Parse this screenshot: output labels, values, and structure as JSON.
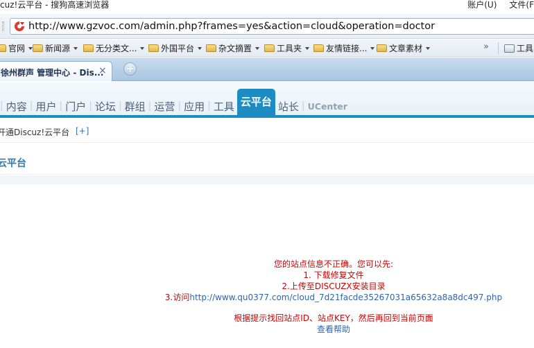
{
  "window": {
    "title": "cuz!云平台 - 搜狗高速浏览器",
    "menus": [
      "账户(U)",
      "文件(F"
    ]
  },
  "address": {
    "url": "http://www.gzvoc.com/admin.php?frames=yes&action=cloud&operation=doctor"
  },
  "bookmarks": {
    "items": [
      {
        "label": "官网",
        "menu": true
      },
      {
        "label": "新闻源",
        "menu": true
      },
      {
        "label": "无分类文...",
        "menu": true
      },
      {
        "label": "外国平台",
        "menu": true
      },
      {
        "label": "杂文摘置",
        "menu": true
      },
      {
        "label": "工具夹",
        "menu": true
      },
      {
        "label": "友情链接...",
        "menu": true
      },
      {
        "label": "文章素材",
        "menu": true
      }
    ],
    "more": "»",
    "tools_label": "工具"
  },
  "tabs": {
    "active_title": "徐州群声 管理中心 - Dis...",
    "close": "×",
    "new_tab": "+"
  },
  "admin_nav": {
    "items": [
      "内容",
      "用户",
      "门户",
      "论坛",
      "群组",
      "运营",
      "应用",
      "工具",
      "云平台",
      "站长",
      "UCenter"
    ],
    "active_index": 8
  },
  "breadcrumb": {
    "text": "开通Discuz!云平台",
    "action": "[+]"
  },
  "section": {
    "title": "云平台"
  },
  "message": {
    "line1": "您的站点信息不正确。您可以先:",
    "line2": "1. 下载修复文件",
    "line3": "2.上传至DISCUZX安装目录",
    "line4_prefix": "3.访问",
    "line4_link": "http://www.qu0377.com/cloud_7d21facde35267031a65632a8a8dc497.php",
    "line5": "根据提示找回站点ID、站点KEY，然后再回到当前页面",
    "help_link": "查看帮助"
  },
  "colors": {
    "accent": "#1d8cc2",
    "error": "#cc0000",
    "link": "#2d64b3"
  }
}
